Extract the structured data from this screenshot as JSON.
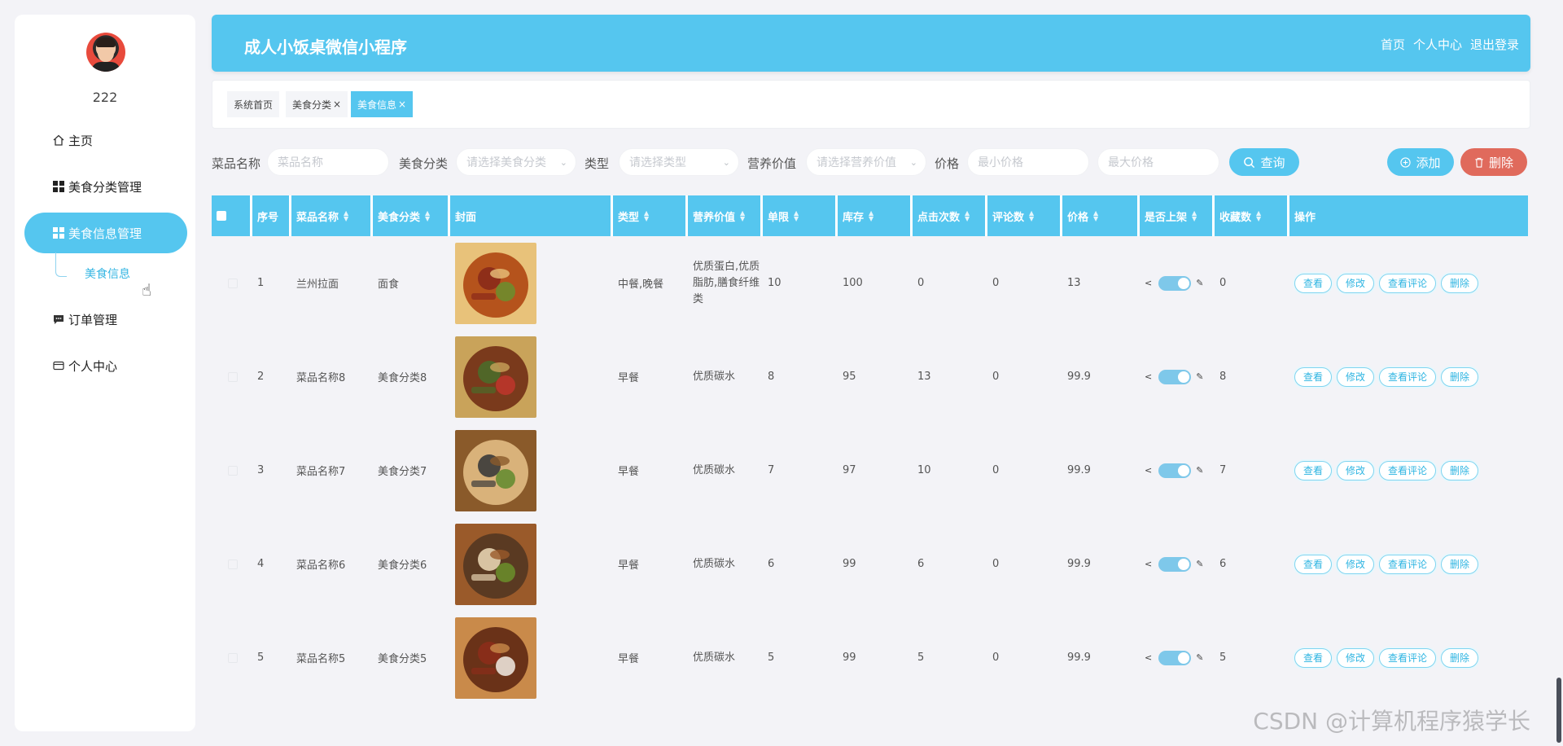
{
  "sidebar": {
    "username": "222",
    "menu": [
      {
        "label": "主页",
        "icon": "home-icon"
      },
      {
        "label": "美食分类管理",
        "icon": "grid-icon"
      },
      {
        "label": "美食信息管理",
        "icon": "grid-icon",
        "active": true
      },
      {
        "label": "订单管理",
        "icon": "chat-icon"
      },
      {
        "label": "个人中心",
        "icon": "card-icon"
      }
    ],
    "submenu_label": "美食信息"
  },
  "header": {
    "title": "成人小饭桌微信小程序",
    "nav": [
      "首页",
      "个人中心",
      "退出登录"
    ]
  },
  "tags": [
    {
      "label": "系统首页",
      "closable": false
    },
    {
      "label": "美食分类",
      "closable": true
    },
    {
      "label": "美食信息",
      "closable": true,
      "active": true
    }
  ],
  "search": {
    "name_label": "菜品名称",
    "name_placeholder": "菜品名称",
    "category_label": "美食分类",
    "category_placeholder": "请选择美食分类",
    "type_label": "类型",
    "type_placeholder": "请选择类型",
    "nutrition_label": "营养价值",
    "nutrition_placeholder": "请选择营养价值",
    "price_label": "价格",
    "min_price_placeholder": "最小价格",
    "max_price_placeholder": "最大价格",
    "query_button": "查询",
    "add_button": "添加",
    "delete_button": "删除"
  },
  "table": {
    "headers": [
      "序号",
      "菜品名称",
      "美食分类",
      "封面",
      "类型",
      "营养价值",
      "单限",
      "库存",
      "点击次数",
      "评论数",
      "价格",
      "是否上架",
      "收藏数",
      "操作"
    ],
    "actions": [
      "查看",
      "修改",
      "查看评论",
      "删除"
    ],
    "rows": [
      {
        "index": "1",
        "name": "兰州拉面",
        "category": "面食",
        "type": "中餐,晚餐",
        "nutrition": "优质蛋白,优质脂肪,膳食纤维类",
        "limit": "10",
        "stock": "100",
        "clicks": "0",
        "comments": "0",
        "price": "13",
        "on_sale": true,
        "favorites": "0",
        "image": "noodle-dish"
      },
      {
        "index": "2",
        "name": "菜品名称8",
        "category": "美食分类8",
        "type": "早餐",
        "nutrition": "优质碳水",
        "limit": "8",
        "stock": "95",
        "clicks": "13",
        "comments": "0",
        "price": "99.9",
        "on_sale": true,
        "favorites": "8",
        "image": "grill-platter"
      },
      {
        "index": "3",
        "name": "菜品名称7",
        "category": "美食分类7",
        "type": "早餐",
        "nutrition": "优质碳水",
        "limit": "7",
        "stock": "97",
        "clicks": "10",
        "comments": "0",
        "price": "99.9",
        "on_sale": true,
        "favorites": "7",
        "image": "wrap-roll"
      },
      {
        "index": "4",
        "name": "菜品名称6",
        "category": "美食分类6",
        "type": "早餐",
        "nutrition": "优质碳水",
        "limit": "6",
        "stock": "99",
        "clicks": "6",
        "comments": "0",
        "price": "99.9",
        "on_sale": true,
        "favorites": "6",
        "image": "meat-skewers"
      },
      {
        "index": "5",
        "name": "菜品名称5",
        "category": "美食分类5",
        "type": "早餐",
        "nutrition": "优质碳水",
        "limit": "5",
        "stock": "99",
        "clicks": "5",
        "comments": "0",
        "price": "99.9",
        "on_sale": true,
        "favorites": "5",
        "image": "kebab-plate"
      }
    ]
  },
  "watermark": "CSDN @计算机程序猿学长",
  "colors": {
    "accent": "#55c6ef",
    "danger": "#e06a5c",
    "page_bg": "#f3f3f7"
  }
}
